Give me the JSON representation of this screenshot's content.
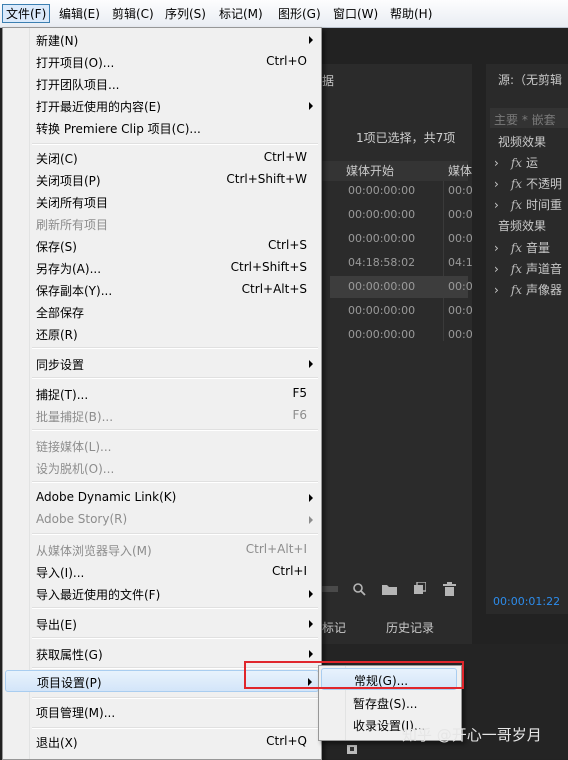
{
  "menubar": {
    "items": [
      {
        "label": "文件(F)"
      },
      {
        "label": "编辑(E)"
      },
      {
        "label": "剪辑(C)"
      },
      {
        "label": "序列(S)"
      },
      {
        "label": "标记(M)"
      },
      {
        "label": "图形(G)"
      },
      {
        "label": "窗口(W)"
      },
      {
        "label": "帮助(H)"
      }
    ]
  },
  "background": {
    "project_tab_fragment": "据",
    "selection_info": "1项已选择，共7项",
    "column_media_start": "媒体开始",
    "column_media_fragment": "媒体",
    "rows": [
      {
        "start": "00:00:00:00",
        "end": "00:0"
      },
      {
        "start": "00:00:00:00",
        "end": "00:0"
      },
      {
        "start": "00:00:00:00",
        "end": "00:0"
      },
      {
        "start": "04:18:58:02",
        "end": "04:1"
      },
      {
        "start": "00:00:00:00",
        "end": "00:0"
      },
      {
        "start": "00:00:00:00",
        "end": "00:0"
      },
      {
        "start": "00:00:00:00",
        "end": "00:0"
      }
    ],
    "source_panel_title": "源:（无剪辑",
    "source_subtitle": "主要 * 嵌套",
    "video_effects": "视频效果",
    "audio_effects": "音频效果",
    "video_fx": [
      "运",
      "不透明",
      "时间重"
    ],
    "audio_fx": [
      "音量",
      "声道音",
      "声像器"
    ],
    "timecode": "00:00:01:22",
    "bottom_tab_marker_fragment": "标记",
    "bottom_tab_history": "历史记录"
  },
  "file_menu": {
    "items": [
      {
        "label": "新建(N)",
        "shortcut": "",
        "submenu": true,
        "disabled": false
      },
      {
        "label": "打开项目(O)...",
        "shortcut": "Ctrl+O",
        "submenu": false,
        "disabled": false
      },
      {
        "label": "打开团队项目...",
        "shortcut": "",
        "submenu": false,
        "disabled": false
      },
      {
        "label": "打开最近使用的内容(E)",
        "shortcut": "",
        "submenu": true,
        "disabled": false
      },
      {
        "label": "转换 Premiere Clip 项目(C)...",
        "shortcut": "",
        "submenu": false,
        "disabled": false
      },
      {
        "label": "关闭(C)",
        "shortcut": "Ctrl+W",
        "submenu": false,
        "disabled": false
      },
      {
        "label": "关闭项目(P)",
        "shortcut": "Ctrl+Shift+W",
        "submenu": false,
        "disabled": false
      },
      {
        "label": "关闭所有项目",
        "shortcut": "",
        "submenu": false,
        "disabled": false
      },
      {
        "label": "刷新所有项目",
        "shortcut": "",
        "submenu": false,
        "disabled": true
      },
      {
        "label": "保存(S)",
        "shortcut": "Ctrl+S",
        "submenu": false,
        "disabled": false
      },
      {
        "label": "另存为(A)...",
        "shortcut": "Ctrl+Shift+S",
        "submenu": false,
        "disabled": false
      },
      {
        "label": "保存副本(Y)...",
        "shortcut": "Ctrl+Alt+S",
        "submenu": false,
        "disabled": false
      },
      {
        "label": "全部保存",
        "shortcut": "",
        "submenu": false,
        "disabled": false
      },
      {
        "label": "还原(R)",
        "shortcut": "",
        "submenu": false,
        "disabled": false
      },
      {
        "label": "同步设置",
        "shortcut": "",
        "submenu": true,
        "disabled": false
      },
      {
        "label": "捕捉(T)...",
        "shortcut": "F5",
        "submenu": false,
        "disabled": false
      },
      {
        "label": "批量捕捉(B)...",
        "shortcut": "F6",
        "submenu": false,
        "disabled": true
      },
      {
        "label": "链接媒体(L)...",
        "shortcut": "",
        "submenu": false,
        "disabled": true
      },
      {
        "label": "设为脱机(O)...",
        "shortcut": "",
        "submenu": false,
        "disabled": true
      },
      {
        "label": "Adobe Dynamic Link(K)",
        "shortcut": "",
        "submenu": true,
        "disabled": false
      },
      {
        "label": "Adobe Story(R)",
        "shortcut": "",
        "submenu": true,
        "disabled": true
      },
      {
        "label": "从媒体浏览器导入(M)",
        "shortcut": "Ctrl+Alt+I",
        "submenu": false,
        "disabled": true
      },
      {
        "label": "导入(I)...",
        "shortcut": "Ctrl+I",
        "submenu": false,
        "disabled": false
      },
      {
        "label": "导入最近使用的文件(F)",
        "shortcut": "",
        "submenu": true,
        "disabled": false
      },
      {
        "label": "导出(E)",
        "shortcut": "",
        "submenu": true,
        "disabled": false
      },
      {
        "label": "获取属性(G)",
        "shortcut": "",
        "submenu": true,
        "disabled": false
      },
      {
        "label": "项目设置(P)",
        "shortcut": "",
        "submenu": true,
        "disabled": false
      },
      {
        "label": "项目管理(M)...",
        "shortcut": "",
        "submenu": false,
        "disabled": false
      },
      {
        "label": "退出(X)",
        "shortcut": "Ctrl+Q",
        "submenu": false,
        "disabled": false
      }
    ]
  },
  "project_settings_submenu": {
    "items": [
      {
        "label": "常规(G)..."
      },
      {
        "label": "暂存盘(S)..."
      },
      {
        "label": "收录设置(I)..."
      }
    ]
  },
  "watermark": "知乎 @开心一哥岁月",
  "colors": {
    "highlight": "#d3e5f9",
    "red_box": "#e0262c",
    "timecode": "#2d8ceb"
  }
}
